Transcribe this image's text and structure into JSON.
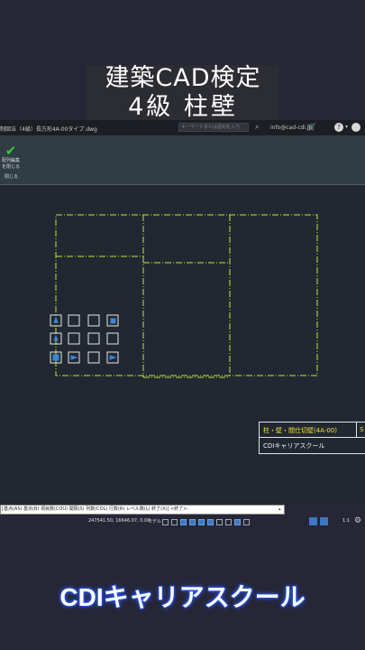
{
  "overlay": {
    "title_line1": "建築CAD検定",
    "title_line2": "4級 柱壁",
    "brand": "CDIキャリアスクール"
  },
  "titlebar": {
    "filename": "制図法（4級）長方形4A-00タイプ.dwg",
    "search_placeholder": "キーワードまたは語句を入力",
    "user": "info@cad-cdi.jp"
  },
  "ribbon": {
    "close_array_label": "配列編集を閉じる",
    "panel_label": "閉じる"
  },
  "drawing": {
    "titleblock_title": "柱・壁・間仕切壁(4A-00)",
    "titleblock_sheet": "S",
    "titleblock_school": "CDIキャリアスクール",
    "colors": {
      "centerline": "#c8e040",
      "grips": "#3a86d8",
      "grid_box": "#e6e6e6"
    }
  },
  "command": {
    "text": "[基点(AS) 基点(B) 項目数(COU) 間隔(S) 列数(COL) 行数(R) レベル数(L) 終了(X)] <終了>:"
  },
  "status": {
    "coordinates": "247541.50, 16646.07, 0.00",
    "model_label": "モデル",
    "scale": "1:1"
  }
}
